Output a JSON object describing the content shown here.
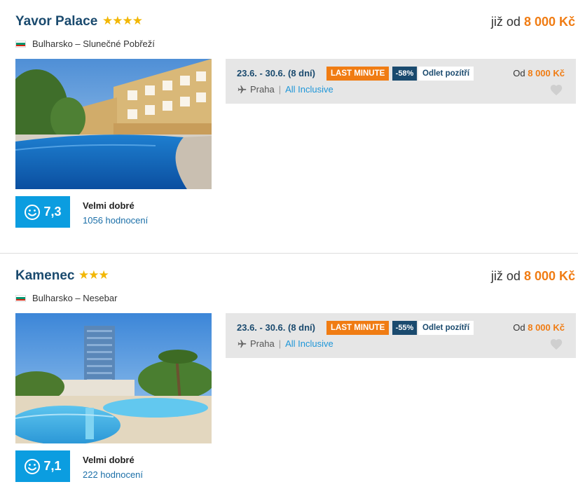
{
  "hotels": [
    {
      "name": "Yavor Palace",
      "stars": "★★★★",
      "price_prefix": "již od",
      "price": "8 000 Kč",
      "location": "Bulharsko – Slunečné Pobřeží",
      "rating": "7,3",
      "rating_label": "Velmi dobré",
      "reviews": "1056 hodnocení",
      "offer": {
        "dates": "23.6. - 30.6. (8 dní)",
        "badge": "LAST MINUTE",
        "discount": "-58%",
        "departure_note": "Odlet pozítří",
        "from_prefix": "Od",
        "from_price": "8 000 Kč",
        "origin": "Praha",
        "board": "All Inclusive"
      }
    },
    {
      "name": "Kamenec",
      "stars": "★★★",
      "price_prefix": "již od",
      "price": "8 000 Kč",
      "location": "Bulharsko – Nesebar",
      "rating": "7,1",
      "rating_label": "Velmi dobré",
      "reviews": "222 hodnocení",
      "offer": {
        "dates": "23.6. - 30.6. (8 dní)",
        "badge": "LAST MINUTE",
        "discount": "-55%",
        "departure_note": "Odlet pozítří",
        "from_prefix": "Od",
        "from_price": "8 000 Kč",
        "origin": "Praha",
        "board": "All Inclusive"
      }
    }
  ],
  "colors": {
    "title": "#1a4a6e",
    "price_accent": "#f07c13",
    "rating_bg": "#0b9de0",
    "link": "#1e96d8",
    "offer_bg": "#e6e6e6"
  },
  "icons": [
    "bulgaria-flag-icon",
    "smiley-icon",
    "plane-icon",
    "heart-icon"
  ]
}
